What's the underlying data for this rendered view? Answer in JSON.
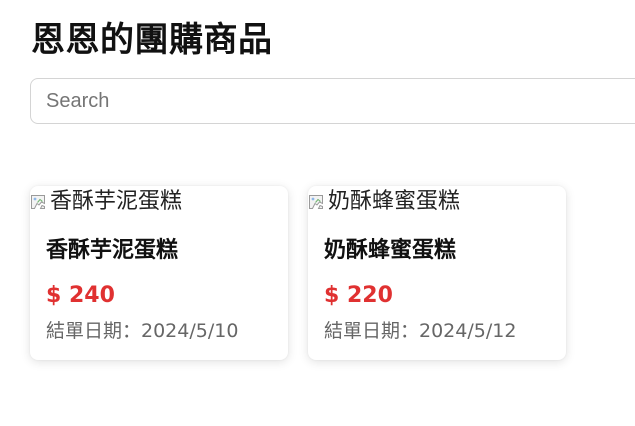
{
  "page": {
    "title": "恩恩的團購商品"
  },
  "search": {
    "placeholder": "Search",
    "value": ""
  },
  "colors": {
    "price": "#e03131",
    "date_text": "#666666",
    "border": "#d4d4d4"
  },
  "products": [
    {
      "image_alt": "香酥芋泥蛋糕",
      "image_icon": "broken-image-icon",
      "name": "香酥芋泥蛋糕",
      "price": "$ 240",
      "end_date": "結單日期：2024/5/10"
    },
    {
      "image_alt": "奶酥蜂蜜蛋糕",
      "image_icon": "broken-image-icon",
      "name": "奶酥蜂蜜蛋糕",
      "price": "$ 220",
      "end_date": "結單日期：2024/5/12"
    }
  ]
}
